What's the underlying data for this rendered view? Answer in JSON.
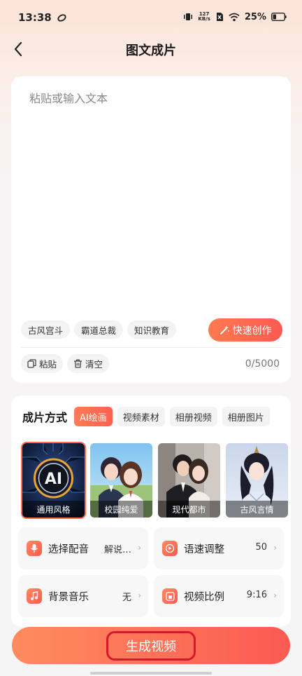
{
  "status_bar": {
    "time": "13:38",
    "net_speed_value": "127",
    "net_speed_unit": "KB/s",
    "battery": "25%"
  },
  "nav": {
    "title": "图文成片"
  },
  "text_card": {
    "placeholder": "粘贴或输入文本",
    "tags": [
      "古风宫斗",
      "霸道总裁",
      "知识教育"
    ],
    "quick_create_label": "快速创作",
    "paste_label": "粘贴",
    "clear_label": "清空",
    "char_count": "0/5000"
  },
  "options": {
    "mode_label": "成片方式",
    "tabs": [
      "AI绘画",
      "视频素材",
      "相册视频",
      "相册图片"
    ],
    "active_tab": "AI绘画",
    "styles": [
      "通用风格",
      "校园纯爱",
      "现代都市",
      "古风言情"
    ],
    "selected_style": "通用风格",
    "ai_badge": "AI",
    "settings": {
      "voice": {
        "label": "选择配音",
        "value": "解说…"
      },
      "speed": {
        "label": "语速调整",
        "value": "50"
      },
      "music": {
        "label": "背景音乐",
        "value": "无"
      },
      "ratio": {
        "label": "视频比例",
        "value": "9:16"
      }
    }
  },
  "generate_label": "生成视频",
  "colors": {
    "accent": "#fb5a52",
    "accent_light": "#ff8c5f",
    "highlight_outline": "#d8192c"
  }
}
